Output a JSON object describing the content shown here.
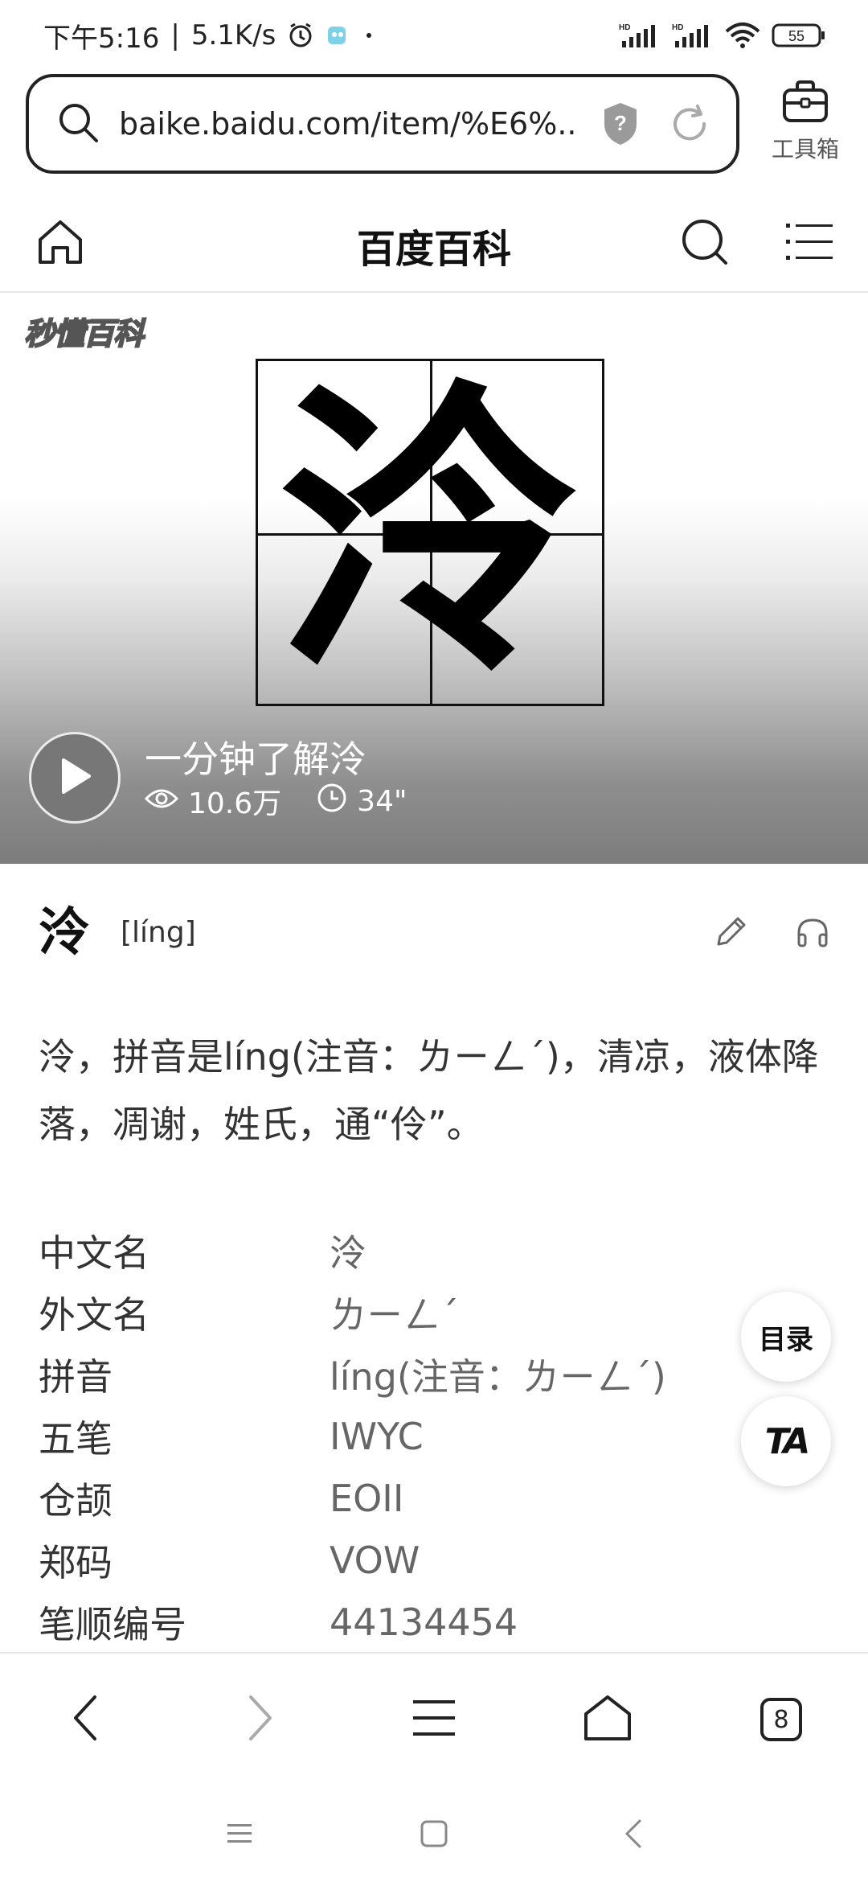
{
  "status_bar": {
    "time": "下午5:16",
    "net_speed": "5.1K/s",
    "battery": "55"
  },
  "address_bar": {
    "url": "baike.baidu.com/item/%E6%...",
    "toolbox_label": "工具箱"
  },
  "site_header": {
    "title": "百度百科"
  },
  "hero": {
    "logo": "秒懂百科",
    "character": "泠",
    "video_title": "一分钟了解泠",
    "views": "10.6万",
    "duration": "34\""
  },
  "entry": {
    "character": "泠",
    "pinyin": "[líng]",
    "summary": "泠，拼音是líng(注音：ㄌㄧㄥˊ)，清凉，液体降落，凋谢，姓氏，通“伶”。"
  },
  "basic_info": [
    {
      "key": "中文名",
      "value": "泠"
    },
    {
      "key": "外文名",
      "value": "ㄌㄧㄥˊ"
    },
    {
      "key": "拼音",
      "value": "líng(注音：ㄌㄧㄥˊ)"
    },
    {
      "key": "五笔",
      "value": "IWYC"
    },
    {
      "key": "仓颉",
      "value": "EOII"
    },
    {
      "key": "郑码",
      "value": "VOW"
    },
    {
      "key": "笔顺编号",
      "value": "44134454"
    }
  ],
  "floating": {
    "toc_label": "目录",
    "ta_label": "TA"
  },
  "bottom_bar": {
    "tab_count": "8"
  },
  "colors": {
    "text": "#222222",
    "muted": "#666666",
    "divider": "#e8e8e8"
  }
}
